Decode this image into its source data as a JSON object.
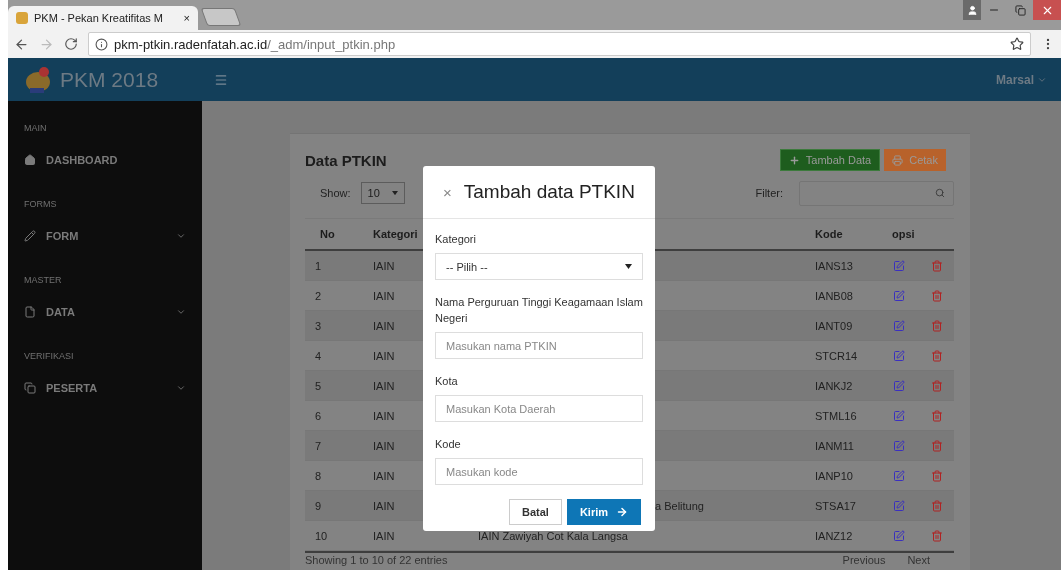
{
  "browser": {
    "tab_title": "PKM - Pekan Kreatifitas M",
    "tab_close": "×",
    "url_host": "pkm-ptkin.radenfatah.ac.id",
    "url_path": "/_adm/input_ptkin.php"
  },
  "header": {
    "logo_text": "PKM 2018",
    "user": "Marsal"
  },
  "sidebar": {
    "sections": [
      {
        "label": "MAIN",
        "items": [
          {
            "label": "DASHBOARD",
            "expandable": false
          }
        ]
      },
      {
        "label": "FORMS",
        "items": [
          {
            "label": "FORM",
            "expandable": true
          }
        ]
      },
      {
        "label": "MASTER",
        "items": [
          {
            "label": "DATA",
            "expandable": true
          }
        ]
      },
      {
        "label": "VERIFIKASI",
        "items": [
          {
            "label": "PESERTA",
            "expandable": true
          }
        ]
      }
    ]
  },
  "page": {
    "title": "Data PTKIN",
    "add_button": "Tambah Data",
    "print_button": "Cetak",
    "show_label": "Show:",
    "show_value": "10",
    "filter_label": "Filter:"
  },
  "table": {
    "columns": [
      {
        "label": "No"
      },
      {
        "label": "Kategori"
      },
      {
        "label": "Kode"
      },
      {
        "label": "opsi"
      }
    ],
    "rows": [
      {
        "no": "1",
        "kategori": "IAIN",
        "kode": "IANS13"
      },
      {
        "no": "2",
        "kategori": "IAIN",
        "kode": "IANB08"
      },
      {
        "no": "3",
        "kategori": "IAIN",
        "kode": "IANT09"
      },
      {
        "no": "4",
        "kategori": "IAIN",
        "kode": "STCR14"
      },
      {
        "no": "5",
        "kategori": "IAIN",
        "kode": "IANKJ2"
      },
      {
        "no": "6",
        "kategori": "IAIN",
        "kode": "STML16"
      },
      {
        "no": "7",
        "kategori": "IAIN",
        "kode": "IANM11"
      },
      {
        "no": "8",
        "kategori": "IAIN",
        "kode": "IANP10"
      },
      {
        "no": "9",
        "kategori": "IAIN",
        "nama": "a Belitung",
        "covered": true,
        "kode": "STSA17"
      },
      {
        "no": "10",
        "kategori": "IAIN",
        "nama": "IAIN Zawiyah Cot Kala Langsa",
        "covered": false,
        "kode": "IANZ12"
      }
    ]
  },
  "footer": {
    "info": "Showing 1 to 10 of 22 entries",
    "previous": "Previous",
    "next": "Next"
  },
  "modal": {
    "close": "×",
    "title": "Tambah data PTKIN",
    "fields": [
      {
        "kind": "select",
        "label": "Kategori",
        "value": "-- Pilih --"
      },
      {
        "kind": "text",
        "label": "Nama Perguruan Tinggi Keagamaan Islam Negeri",
        "placeholder": "Masukan nama PTKIN"
      },
      {
        "kind": "text",
        "label": "Kota",
        "placeholder": "Masukan Kota Daerah"
      },
      {
        "kind": "text",
        "label": "Kode",
        "placeholder": "Masukan kode"
      }
    ],
    "cancel": "Batal",
    "submit": "Kirim"
  }
}
